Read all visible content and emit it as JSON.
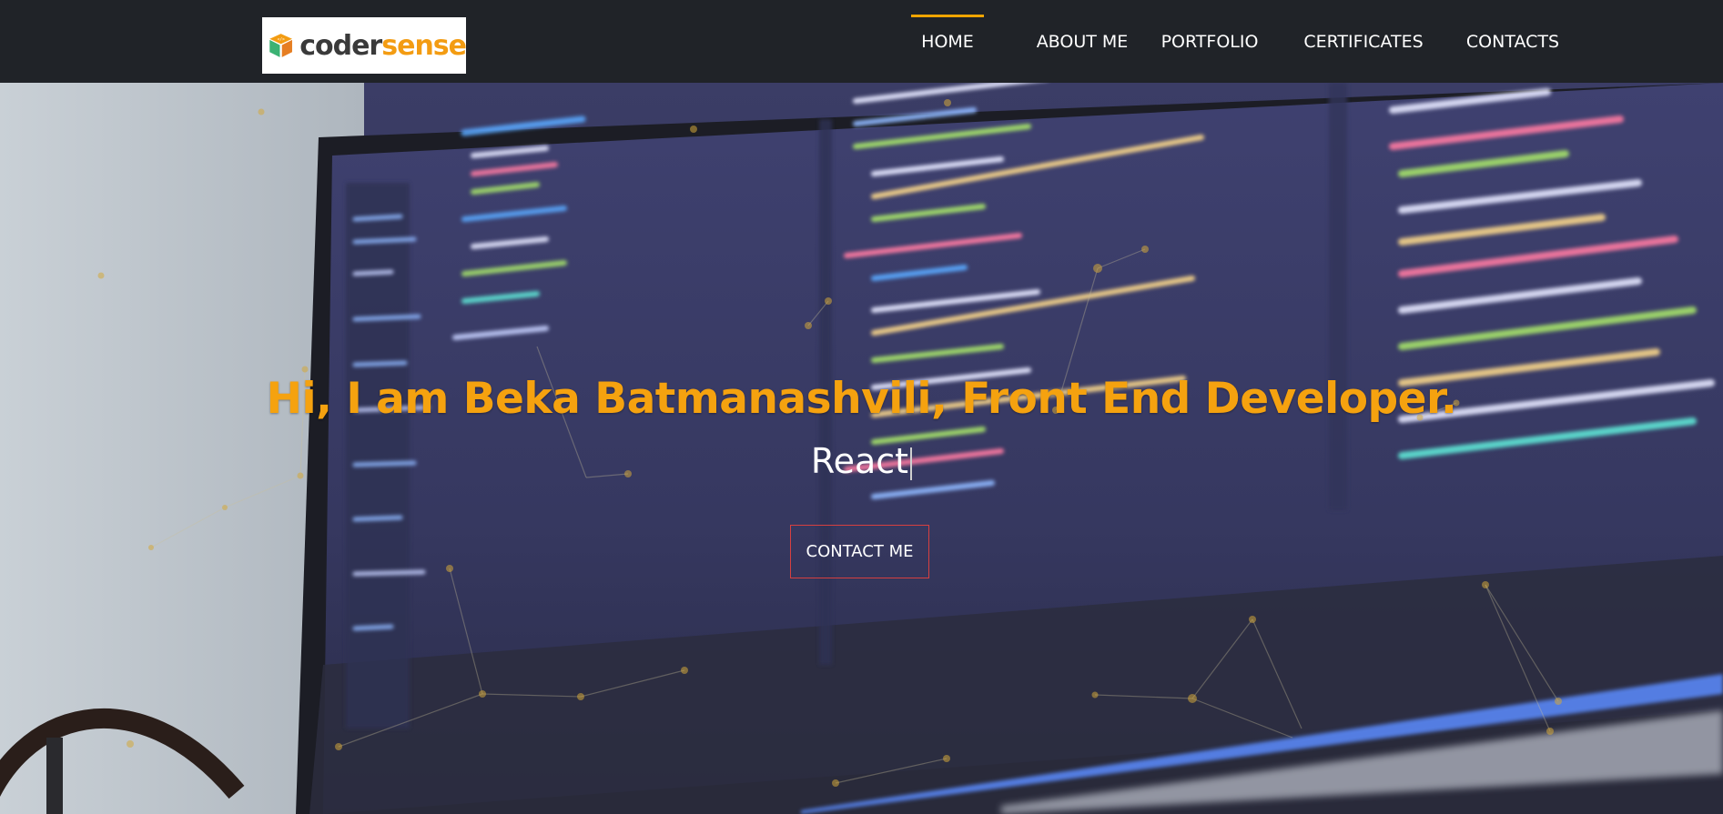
{
  "brand": {
    "name_part1": "coder",
    "name_part2": "sense",
    "icon": "cube-logo-icon"
  },
  "nav": {
    "items": [
      {
        "label": "HOME",
        "active": true
      },
      {
        "label": "ABOUT ME",
        "active": false
      },
      {
        "label": "PORTFOLIO",
        "active": false
      },
      {
        "label": "CERTIFICATES",
        "active": false
      },
      {
        "label": "CONTACTS",
        "active": false
      }
    ]
  },
  "hero": {
    "title": "Hi, I am Beka Batmanashvili, Front End Developer.",
    "typed_text": "React",
    "cta_label": "CONTACT ME"
  },
  "colors": {
    "navbar": "#202328",
    "accent": "#f0a500",
    "title": "#f5a20f",
    "cta_border": "#d64040"
  }
}
